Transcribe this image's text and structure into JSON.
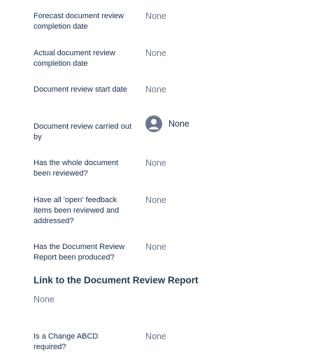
{
  "fields": [
    {
      "label": "Forecast document review completion date",
      "value": "None"
    },
    {
      "label": "Actual document review completion date",
      "value": "None"
    },
    {
      "label": "Document review start date",
      "value": "None"
    },
    {
      "label": "Document review carried out by",
      "value": "None",
      "icon": "user-avatar-icon"
    },
    {
      "label": "Has the whole document been reviewed?",
      "value": "None"
    },
    {
      "label": "Have all 'open' feedback items been reviewed and addressed?",
      "value": "None"
    },
    {
      "label": "Has the Document Review Report been produced?",
      "value": "None"
    }
  ],
  "link_section": {
    "heading": "Link to the Document Review Report",
    "value": "None"
  },
  "change_field": {
    "label": "Is a Change ABCD required?",
    "value": "None"
  }
}
